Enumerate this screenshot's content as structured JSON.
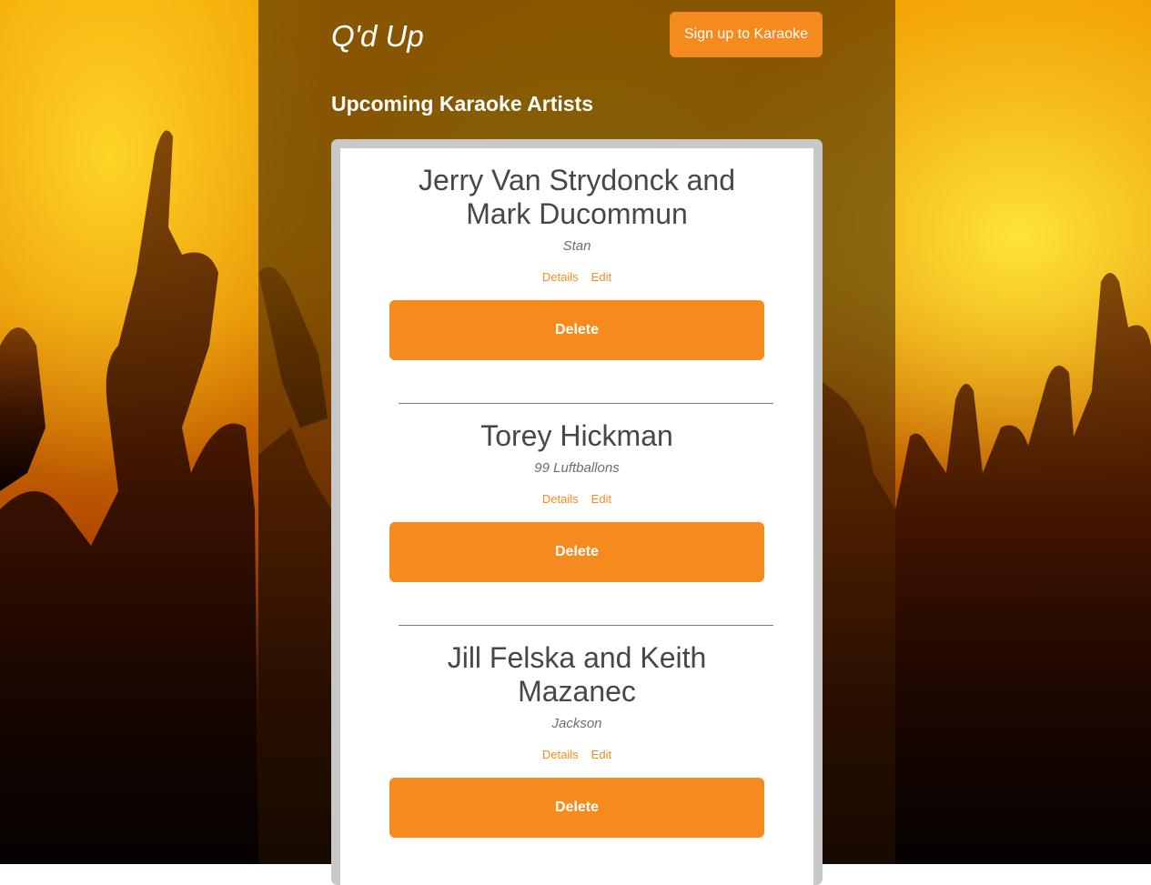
{
  "header": {
    "logo": "Q'd Up",
    "signup_label": "Sign up to Karaoke"
  },
  "section_title": "Upcoming Karaoke Artists",
  "entries": [
    {
      "artist": "Jerry Van Strydonck and Mark Ducommun",
      "song": "Stan",
      "details_label": "Details",
      "edit_label": "Edit",
      "delete_label": "Delete"
    },
    {
      "artist": "Torey Hickman",
      "song": "99 Luftballons",
      "details_label": "Details",
      "edit_label": "Edit",
      "delete_label": "Delete"
    },
    {
      "artist": "Jill Felska and Keith Mazanec",
      "song": "Jackson",
      "details_label": "Details",
      "edit_label": "Edit",
      "delete_label": "Delete"
    }
  ],
  "colors": {
    "accent": "#f58b1f",
    "text": "#474747",
    "muted": "#6d6d6d"
  }
}
